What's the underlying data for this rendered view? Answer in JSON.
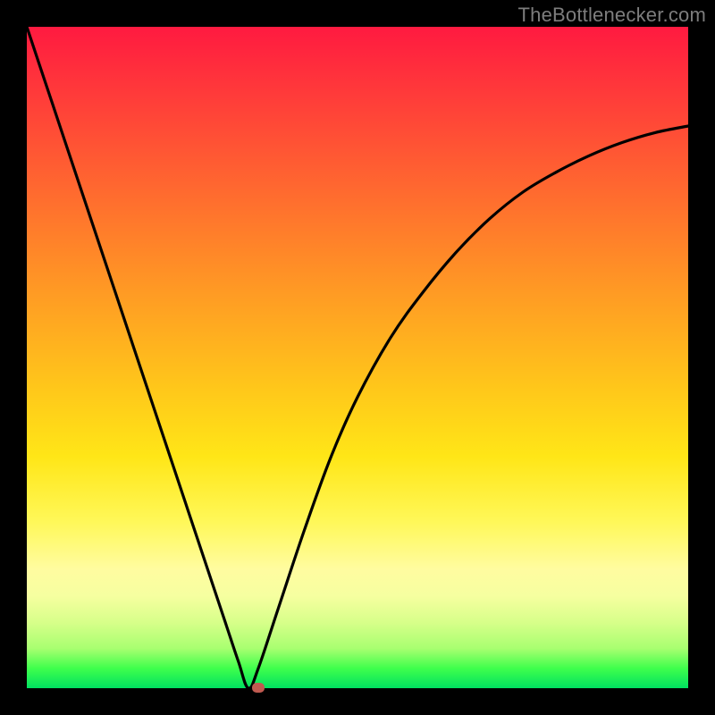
{
  "watermark": "TheBottlenecker.com",
  "colors": {
    "frame": "#000000",
    "gradient_top": "#ff1a40",
    "gradient_mid": "#ffe617",
    "gradient_bottom": "#00e060",
    "curve": "#000000",
    "marker": "#c05a50"
  },
  "chart_data": {
    "type": "line",
    "title": "",
    "xlabel": "",
    "ylabel": "",
    "xlim": [
      0,
      100
    ],
    "ylim": [
      0,
      100
    ],
    "x": [
      0,
      4,
      8,
      12,
      16,
      20,
      24,
      28,
      30,
      32,
      33.5,
      35,
      38,
      42,
      46,
      50,
      55,
      60,
      65,
      70,
      75,
      80,
      85,
      90,
      95,
      100
    ],
    "values": [
      100,
      88,
      76,
      64,
      52,
      40,
      28,
      16,
      10,
      4,
      0,
      3,
      12,
      24,
      35,
      44,
      53,
      60,
      66,
      71,
      75,
      78,
      80.5,
      82.5,
      84,
      85
    ],
    "annotations": [
      {
        "type": "marker",
        "x": 35,
        "y": 0,
        "shape": "rounded-rect",
        "color": "#c05a50"
      }
    ],
    "notes": "V-shaped bottleneck curve over a red→yellow→green vertical gradient; minimum (optimal) near x≈34% where curve touches green band; values are percentages estimated from pixels."
  }
}
